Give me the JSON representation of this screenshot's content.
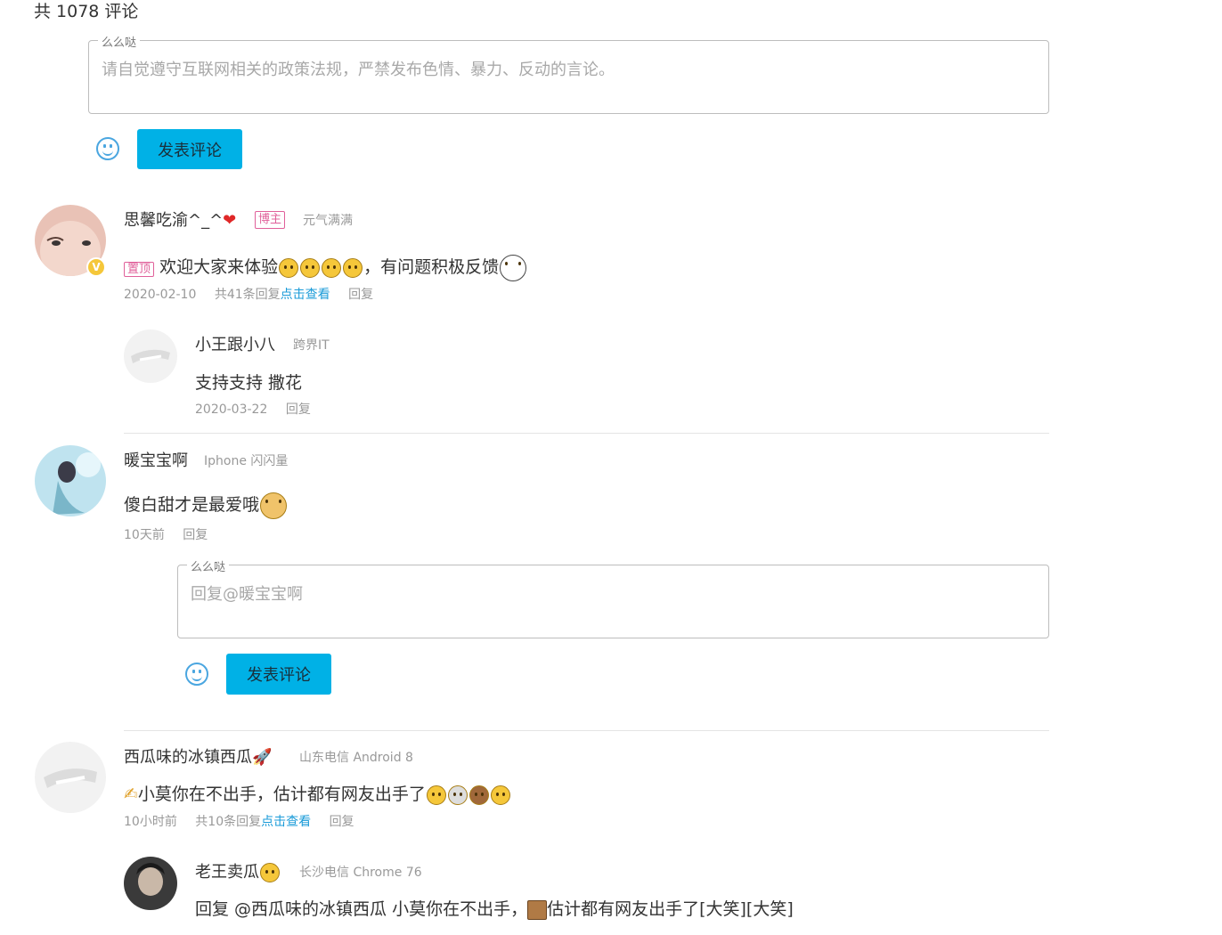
{
  "header": {
    "count_text": "共 1078 评论"
  },
  "composer": {
    "legend": "么么哒",
    "placeholder": "请自觉遵守互联网相关的政策法规，严禁发布色情、暴力、反动的言论。",
    "submit_label": "发表评论"
  },
  "comments": [
    {
      "name": "思馨吃渝^_^",
      "badge": "博主",
      "tagline": "元气满满",
      "pin_badge": "置顶",
      "content_a": "欢迎大家来体验",
      "content_b": "，有问题积极反馈",
      "date": "2020-02-10",
      "replies_count": "共41条回复",
      "view_link": "点击查看",
      "reply_label": "回复",
      "verified_mark": "V"
    },
    {
      "name": "暖宝宝啊",
      "tagline": "Iphone 闪闪量",
      "content": "傻白甜才是最爱哦",
      "date": "10天前",
      "reply_label": "回复"
    },
    {
      "name": "西瓜味的冰镇西瓜",
      "tagline": "山东电信 Android 8",
      "content": "小莫你在不出手，估计都有网友出手了",
      "date": "10小时前",
      "replies_count": "共10条回复",
      "view_link": "点击查看",
      "reply_label": "回复"
    }
  ],
  "replies": [
    {
      "name": "小王跟小八",
      "tagline": "跨界IT",
      "content": "支持支持 撒花",
      "date": "2020-03-22",
      "reply_label": "回复"
    },
    {
      "name": "老王卖瓜",
      "tagline": "长沙电信 Chrome 76",
      "content_a": "回复 @西瓜味的冰镇西瓜 小莫你在不出手，",
      "content_b": "估计都有网友出手了[大笑][大笑]"
    }
  ],
  "reply_composer": {
    "legend": "么么哒",
    "placeholder": "回复@暖宝宝啊",
    "submit_label": "发表评论"
  }
}
